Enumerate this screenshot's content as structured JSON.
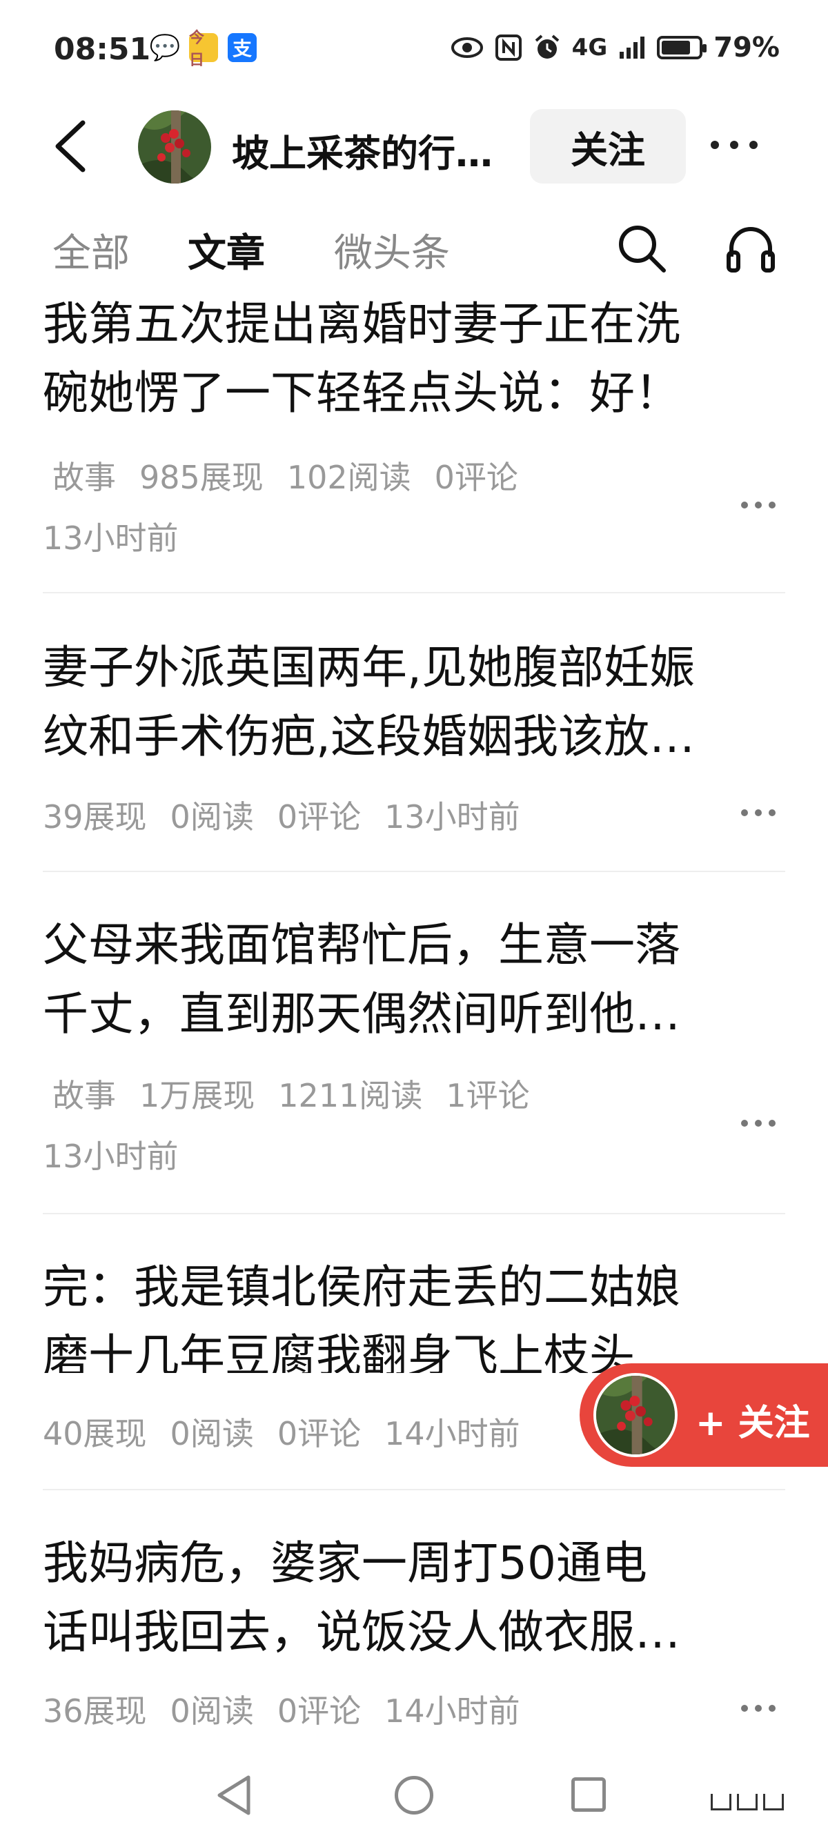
{
  "status_bar": {
    "time": "08:51",
    "toutiao_glyph": "今日",
    "alipay_glyph": "支",
    "wechat_glyph": "💬",
    "network": "4G",
    "battery_level": 0.79,
    "battery_text": "79%"
  },
  "header": {
    "author_name": "坡上采茶的行…",
    "follow_label": "关注"
  },
  "tabs": {
    "all": "全部",
    "articles": "文章",
    "micro": "微头条",
    "active": "文章"
  },
  "articles": [
    {
      "title_line1": "我第五次提出离婚时妻子正在洗",
      "title_line2": "碗她愣了一下轻轻点头说：好！",
      "tag": "故事",
      "impressions": "985展现",
      "reads": "102阅读",
      "comments": "0评论",
      "time": "13小时前"
    },
    {
      "title_line1": "妻子外派英国两年,见她腹部妊娠",
      "title_line2": "纹和手术伤疤,这段婚姻我该放…",
      "impressions": "39展现",
      "reads": "0阅读",
      "comments": "0评论",
      "time": "13小时前"
    },
    {
      "title_line1": "父母来我面馆帮忙后，生意一落",
      "title_line2": "千丈，直到那天偶然间听到他…",
      "tag": "故事",
      "impressions": "1万展现",
      "reads": "1211阅读",
      "comments": "1评论",
      "time": "13小时前"
    },
    {
      "title_line1": "完：我是镇北侯府走丢的二姑娘",
      "title_line2": "磨十几年豆腐我翻身飞上枝头",
      "impressions": "40展现",
      "reads": "0阅读",
      "comments": "0评论",
      "time": "14小时前"
    },
    {
      "title_line1": "我妈病危，婆家一周打50通电",
      "title_line2": "话叫我回去，说饭没人做衣服…",
      "impressions": "36展现",
      "reads": "0阅读",
      "comments": "0评论",
      "time": "14小时前"
    }
  ],
  "floating_follow": {
    "label": "+ 关注"
  },
  "colors": {
    "accent": "#e8453c",
    "meta_text": "#999999",
    "follow_bg": "#f2f2f2"
  },
  "icons": [
    "back-arrow-icon",
    "more-dots-icon",
    "search-icon",
    "headphones-icon",
    "nav-back-icon",
    "nav-home-icon",
    "nav-recent-icon"
  ]
}
